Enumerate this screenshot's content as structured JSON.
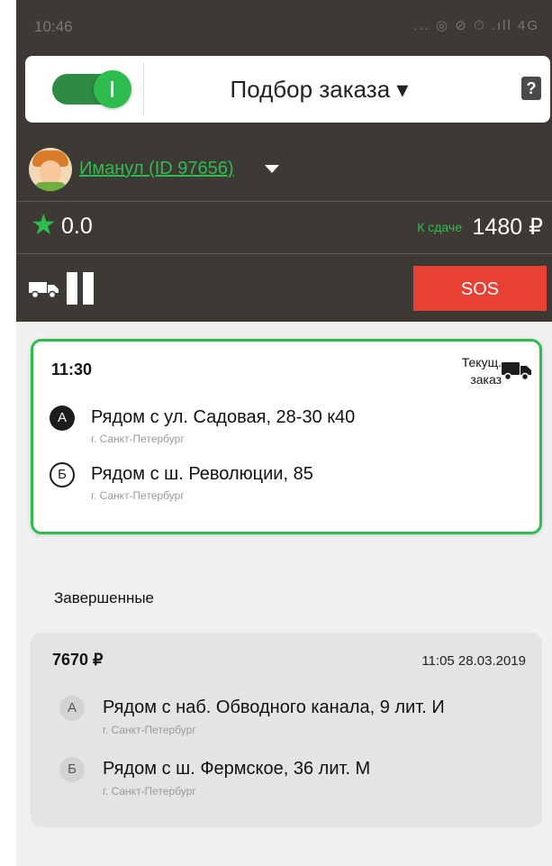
{
  "status_bar": {
    "time": "10:46",
    "icons": "... ◎ ⊘ ⏱ .ıll 4G"
  },
  "header": {
    "mode_title": "Подбор заказа ▾",
    "help_icon": "?",
    "user": {
      "name": "Иманул (ID 97656)"
    },
    "rating": "0.0",
    "change_label": "К сдаче",
    "change_amount": "1480 ₽",
    "sos_label": "SOS",
    "colors": {
      "accent": "#2fbc4f",
      "header_bg": "#3d3935",
      "sos": "#e94035"
    }
  },
  "current_order": {
    "time": "11:30",
    "status_line1": "Текущ.",
    "status_line2": "заказ",
    "stops": [
      {
        "marker": "А",
        "address": "Рядом с ул. Садовая, 28-30 к40",
        "city": "г. Санкт-Петербург"
      },
      {
        "marker": "Б",
        "address": "Рядом с ш. Революции, 85",
        "city": "г. Санкт-Петербург"
      }
    ]
  },
  "completed": {
    "section_title": "Завершенные",
    "orders": [
      {
        "price": "7670 ₽",
        "datetime": "11:05 28.03.2019",
        "stops": [
          {
            "marker": "А",
            "address": "Рядом с наб. Обводного канала, 9 лит. И",
            "city": "г. Санкт-Петербург"
          },
          {
            "marker": "Б",
            "address": "Рядом с ш. Фермское, 36 лит. М",
            "city": "г. Санкт-Петербург"
          }
        ]
      }
    ]
  }
}
